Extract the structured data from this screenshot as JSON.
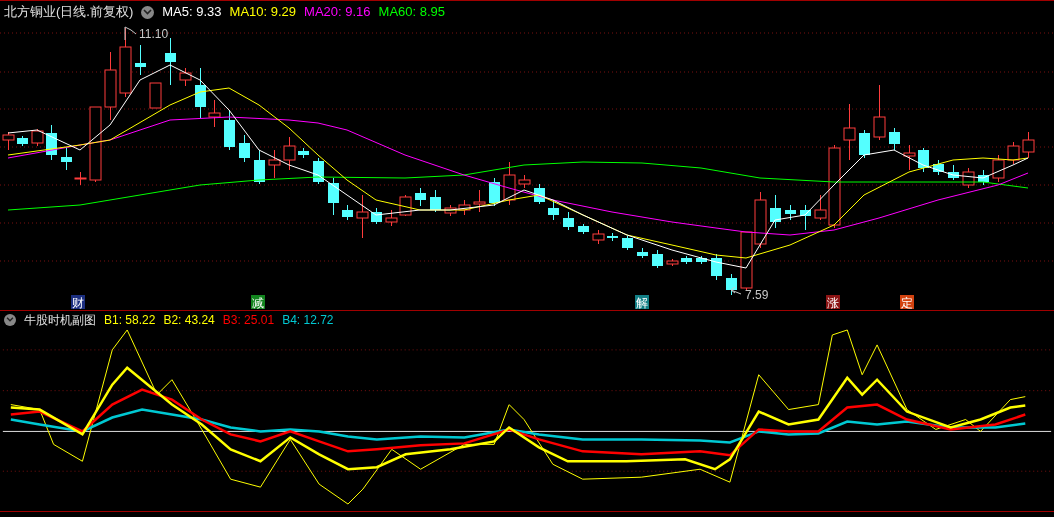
{
  "main_chart": {
    "title": "北方铜业(日线.前复权)",
    "indicators": [
      {
        "label": "MA5: 9.33",
        "color": "#ffffff"
      },
      {
        "label": "MA10: 9.29",
        "color": "#ffff00"
      },
      {
        "label": "MA20: 9.16",
        "color": "#ff00ff"
      },
      {
        "label": "MA60: 8.95",
        "color": "#00ff00"
      }
    ],
    "annotations": [
      {
        "text": "11.10"
      },
      {
        "text": "7.59"
      }
    ],
    "signals": [
      {
        "text": "财",
        "color": "#1c2f80"
      },
      {
        "text": "减",
        "color": "#12841e"
      },
      {
        "text": "解",
        "color": "#127f86"
      },
      {
        "text": "涨",
        "color": "#8c1414"
      },
      {
        "text": "定",
        "color": "#d2420f"
      }
    ]
  },
  "sub_chart": {
    "title": "牛股时机副图",
    "indicators": [
      {
        "label": "B1: 58.22",
        "color": "#ffff00"
      },
      {
        "label": "B2: 43.24",
        "color": "#ffff00"
      },
      {
        "label": "B3: 25.01",
        "color": "#ff0000"
      },
      {
        "label": "B4: 12.72",
        "color": "#00c8d2"
      }
    ]
  }
}
